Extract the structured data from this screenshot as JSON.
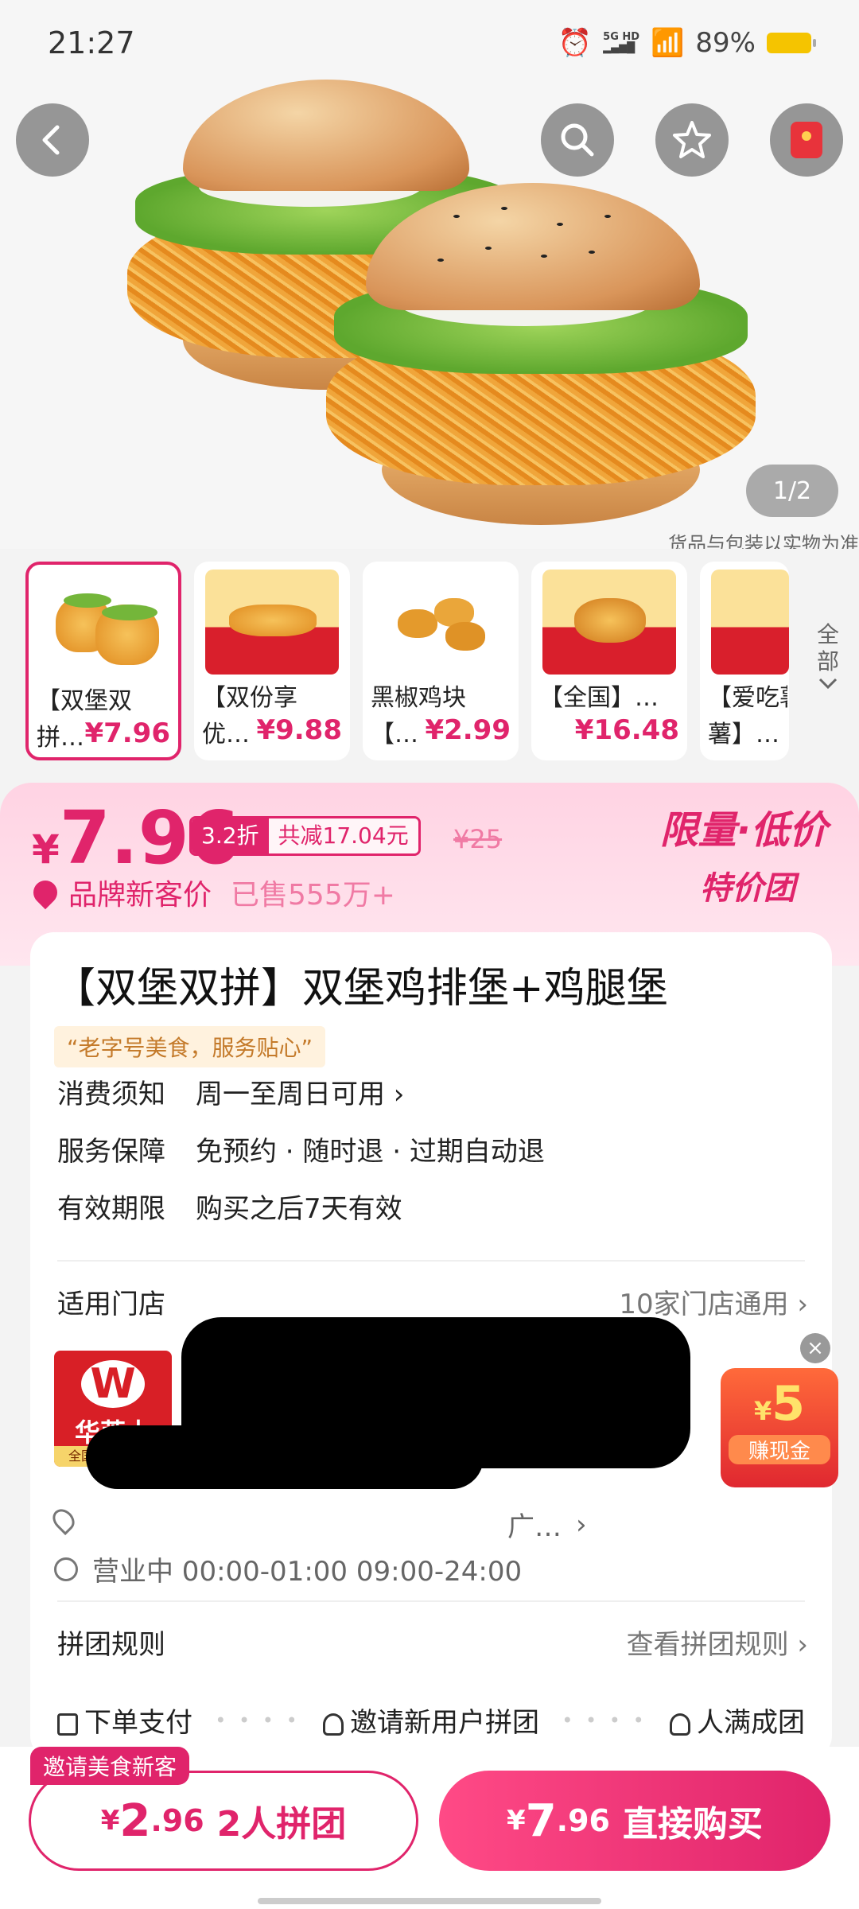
{
  "status_bar": {
    "time": "21:27",
    "network": "5G HD",
    "battery": "89%"
  },
  "hero": {
    "page_indicator": "1/2",
    "note": "货品与包装以实物为准"
  },
  "thumbnails": [
    {
      "line1": "【双堡双",
      "line2": "拼…",
      "price": "¥7.96",
      "selected": true
    },
    {
      "line1": "【双份享",
      "line2": "优…",
      "price": "¥9.88",
      "selected": false
    },
    {
      "line1": "黑椒鸡块",
      "line2": "【…",
      "price": "¥2.99",
      "selected": false
    },
    {
      "line1": "【全国】…",
      "line2": "",
      "price": "¥16.48",
      "selected": false
    },
    {
      "line1": "【爱吃薯",
      "line2": "薯】…",
      "price": "",
      "selected": false
    }
  ],
  "all_button": {
    "label1": "全",
    "label2": "部"
  },
  "price": {
    "currency": "¥",
    "value": "7.96",
    "discount": "3.2折",
    "savings": "共减17.04元",
    "original": "¥25",
    "brand_label": "品牌新客价",
    "sold": "已售555万+",
    "promo_line1": "限量·低价",
    "promo_line2": "特价团"
  },
  "product": {
    "title": "【双堡双拼】双堡鸡排堡+鸡腿堡",
    "slogan": "“老字号美食，服务贴心”",
    "rows": [
      {
        "label": "消费须知",
        "value": "周一至周日可用 ›"
      },
      {
        "label": "服务保障",
        "value": "免预约 · 随时退 · 过期自动退"
      },
      {
        "label": "有效期限",
        "value": "购买之后7天有效"
      }
    ]
  },
  "store": {
    "heading": "适用门店",
    "count": "10家门店通用 ›",
    "logo_name": "华莱士",
    "logo_sub": "全国门店两万家",
    "address_suffix": "广…",
    "hours": "营业中 00:00-01:00 09:00-24:00"
  },
  "rules": {
    "heading": "拼团规则",
    "link": "查看拼团规则 ›",
    "steps": [
      "下单支付",
      "邀请新用户拼团",
      "人满成团"
    ]
  },
  "cash_widget": {
    "amount_currency": "¥",
    "amount": "5",
    "label": "赚现金",
    "close": "×"
  },
  "bottom": {
    "invite_tag": "邀请美食新客",
    "group_currency": "¥",
    "group_int": "2",
    "group_dec": ".96",
    "group_label": "2人拼团",
    "buy_currency": "¥",
    "buy_int": "7",
    "buy_dec": ".96",
    "buy_label": "直接购买"
  },
  "colors": {
    "accent": "#e0246b",
    "banner_bg": "#ffd3e3",
    "brand_red": "#d81f26"
  }
}
